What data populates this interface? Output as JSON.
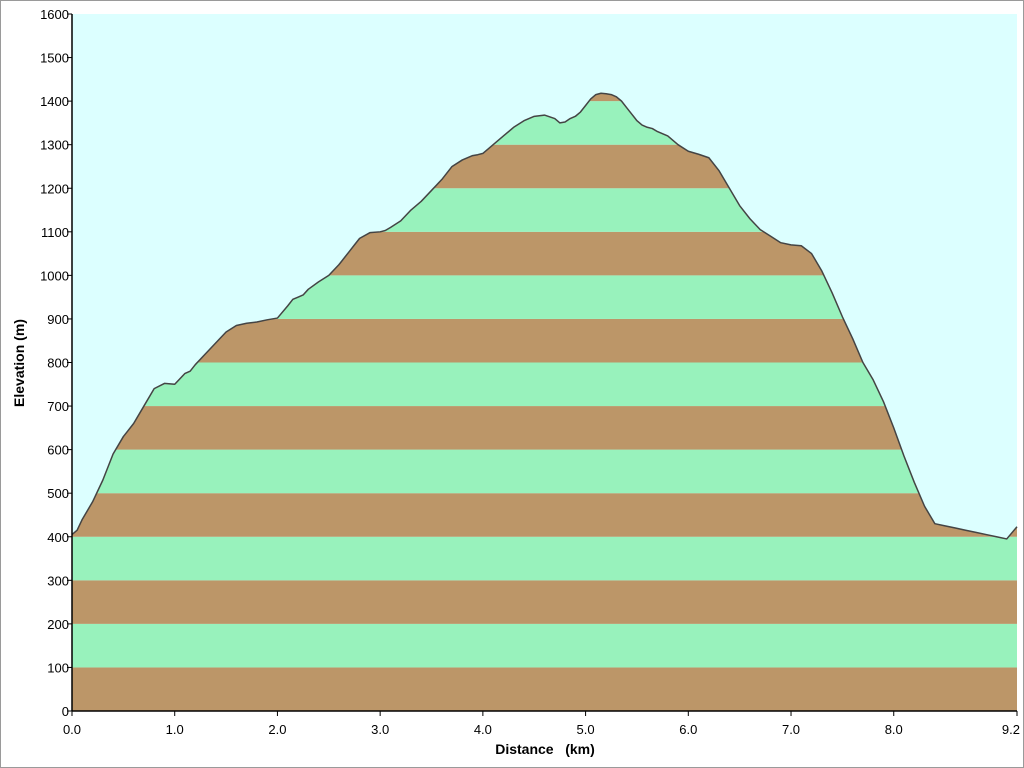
{
  "chart_data": {
    "type": "area",
    "title": "",
    "xlabel": "Distance   (km)",
    "ylabel": "Elevation (m)",
    "xlim": [
      0,
      9.2
    ],
    "ylim": [
      0,
      1600
    ],
    "x_ticks": [
      0.0,
      1.0,
      2.0,
      3.0,
      4.0,
      5.0,
      6.0,
      7.0,
      8.0,
      9.2
    ],
    "x_tick_labels": [
      "0.0",
      "1.0",
      "2.0",
      "3.0",
      "4.0",
      "5.0",
      "6.0",
      "7.0",
      "8.0",
      "9.2"
    ],
    "y_ticks": [
      0,
      100,
      200,
      300,
      400,
      500,
      600,
      700,
      800,
      900,
      1000,
      1100,
      1200,
      1300,
      1400,
      1500,
      1600
    ],
    "y_tick_labels": [
      "0",
      "100",
      "200",
      "300",
      "400",
      "500",
      "600",
      "700",
      "800",
      "900",
      "1000",
      "1100",
      "1200",
      "1300",
      "1400",
      "1500",
      "1600"
    ],
    "band_step": 100,
    "band_colors": [
      "#bc9668",
      "#98f2bc"
    ],
    "background_color": "#dcffff",
    "line_color": "#444444",
    "x": [
      0.0,
      0.05,
      0.1,
      0.2,
      0.3,
      0.4,
      0.5,
      0.6,
      0.7,
      0.8,
      0.9,
      1.0,
      1.1,
      1.15,
      1.2,
      1.3,
      1.4,
      1.5,
      1.6,
      1.7,
      1.8,
      1.9,
      2.0,
      2.1,
      2.15,
      2.2,
      2.25,
      2.3,
      2.4,
      2.5,
      2.6,
      2.7,
      2.75,
      2.8,
      2.9,
      3.0,
      3.05,
      3.1,
      3.2,
      3.3,
      3.4,
      3.5,
      3.6,
      3.7,
      3.8,
      3.9,
      3.95,
      4.0,
      4.1,
      4.2,
      4.3,
      4.4,
      4.5,
      4.6,
      4.7,
      4.75,
      4.8,
      4.85,
      4.9,
      4.95,
      5.0,
      5.05,
      5.1,
      5.15,
      5.2,
      5.25,
      5.3,
      5.35,
      5.4,
      5.45,
      5.5,
      5.55,
      5.6,
      5.65,
      5.7,
      5.8,
      5.9,
      6.0,
      6.1,
      6.2,
      6.3,
      6.4,
      6.5,
      6.6,
      6.7,
      6.8,
      6.9,
      7.0,
      7.1,
      7.2,
      7.3,
      7.4,
      7.5,
      7.6,
      7.7,
      7.8,
      7.9,
      8.0,
      8.1,
      8.2,
      8.3,
      8.4,
      8.5,
      8.6,
      8.7,
      8.8,
      8.9,
      9.0,
      9.1,
      9.2
    ],
    "values": [
      405,
      415,
      440,
      480,
      530,
      590,
      630,
      660,
      700,
      740,
      752,
      750,
      775,
      780,
      795,
      820,
      845,
      870,
      885,
      890,
      893,
      898,
      902,
      930,
      945,
      950,
      955,
      968,
      985,
      1000,
      1025,
      1055,
      1070,
      1085,
      1098,
      1100,
      1103,
      1110,
      1125,
      1150,
      1170,
      1195,
      1220,
      1250,
      1265,
      1275,
      1277,
      1280,
      1300,
      1320,
      1340,
      1355,
      1365,
      1368,
      1360,
      1350,
      1352,
      1360,
      1365,
      1375,
      1390,
      1405,
      1415,
      1418,
      1417,
      1415,
      1410,
      1400,
      1385,
      1370,
      1355,
      1345,
      1340,
      1337,
      1330,
      1320,
      1300,
      1285,
      1278,
      1270,
      1240,
      1200,
      1160,
      1130,
      1105,
      1090,
      1075,
      1070,
      1068,
      1050,
      1010,
      960,
      905,
      855,
      800,
      760,
      710,
      650,
      585,
      525,
      470,
      430,
      425,
      420,
      415,
      410,
      405,
      400,
      395,
      423
    ]
  }
}
